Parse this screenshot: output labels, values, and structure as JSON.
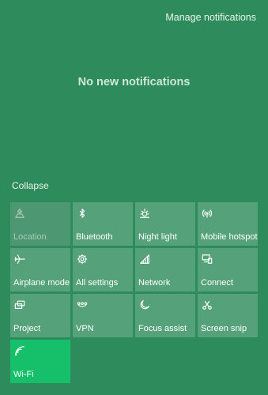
{
  "header": {
    "manage_label": "Manage notifications"
  },
  "notifications": {
    "empty_message": "No new notifications"
  },
  "quick_actions": {
    "collapse_label": "Collapse",
    "tiles": [
      {
        "label": "Location",
        "icon": "location-icon",
        "state": "disabled"
      },
      {
        "label": "Bluetooth",
        "icon": "bluetooth-icon",
        "state": "off"
      },
      {
        "label": "Night light",
        "icon": "brightness-icon",
        "state": "off"
      },
      {
        "label": "Mobile hotspot",
        "icon": "hotspot-icon",
        "state": "off"
      },
      {
        "label": "Airplane mode",
        "icon": "airplane-icon",
        "state": "off"
      },
      {
        "label": "All settings",
        "icon": "gear-icon",
        "state": "off"
      },
      {
        "label": "Network",
        "icon": "network-icon",
        "state": "off"
      },
      {
        "label": "Connect",
        "icon": "connect-icon",
        "state": "off"
      },
      {
        "label": "Project",
        "icon": "project-icon",
        "state": "off"
      },
      {
        "label": "VPN",
        "icon": "vpn-icon",
        "state": "off"
      },
      {
        "label": "Focus assist",
        "icon": "moon-icon",
        "state": "off"
      },
      {
        "label": "Screen snip",
        "icon": "screen-snip-icon",
        "state": "off"
      },
      {
        "label": "Wi-Fi",
        "icon": "wifi-icon",
        "state": "on"
      }
    ]
  },
  "colors": {
    "background": "#2e8b5b",
    "tile": "#55a27a",
    "tile_active": "#16c06a"
  }
}
